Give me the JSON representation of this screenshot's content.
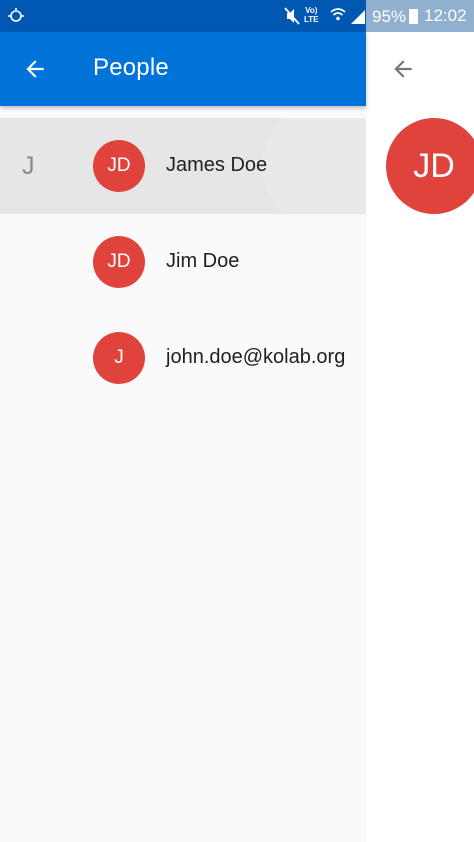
{
  "status_bar": {
    "left_icon": "sync-icon",
    "volte_line1": "Vo)",
    "volte_line2": "LTE",
    "battery_percent": "95%",
    "time": "12:02"
  },
  "app_bar": {
    "back_icon": "arrow-back-icon",
    "title": "People",
    "color": "#0073d9"
  },
  "contacts": [
    {
      "section": "J",
      "initials": "JD",
      "name": "James Doe",
      "selected": true
    },
    {
      "section": "",
      "initials": "JD",
      "name": "Jim Doe",
      "selected": false
    },
    {
      "section": "",
      "initials": "J",
      "name": "john.doe@kolab.org",
      "selected": false
    }
  ],
  "detail": {
    "back_icon": "arrow-back-icon",
    "initials": "JD"
  },
  "colors": {
    "avatar": "#e0433b",
    "status_bar": "#0058b3"
  }
}
